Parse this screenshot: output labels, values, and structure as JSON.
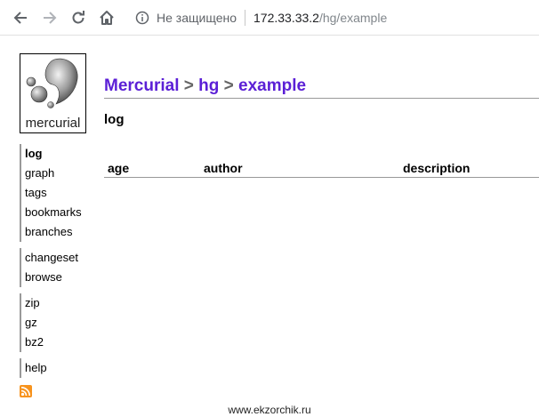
{
  "browser": {
    "security_label": "Не защищено",
    "url_host": "172.33.33.2",
    "url_path": "/hg/example"
  },
  "logo": {
    "text": "mercurial"
  },
  "breadcrumb": {
    "root": "Mercurial",
    "sep1": ">",
    "repo_group": "hg",
    "sep2": ">",
    "repo": "example"
  },
  "page_title": "log",
  "menu": {
    "group1": [
      "log",
      "graph",
      "tags",
      "bookmarks",
      "branches"
    ],
    "group2": [
      "changeset",
      "browse"
    ],
    "group3": [
      "zip",
      "gz",
      "bz2"
    ],
    "group4": [
      "help"
    ],
    "active": "log"
  },
  "table": {
    "headers": [
      "age",
      "author",
      "description"
    ],
    "rows": []
  },
  "watermark": "www.ekzorchik.ru",
  "colors": {
    "link": "#5b1fd6",
    "rss": "#f7931e"
  },
  "icons": [
    "back-arrow-icon",
    "forward-arrow-icon",
    "reload-icon",
    "home-icon",
    "info-icon",
    "rss-icon"
  ]
}
